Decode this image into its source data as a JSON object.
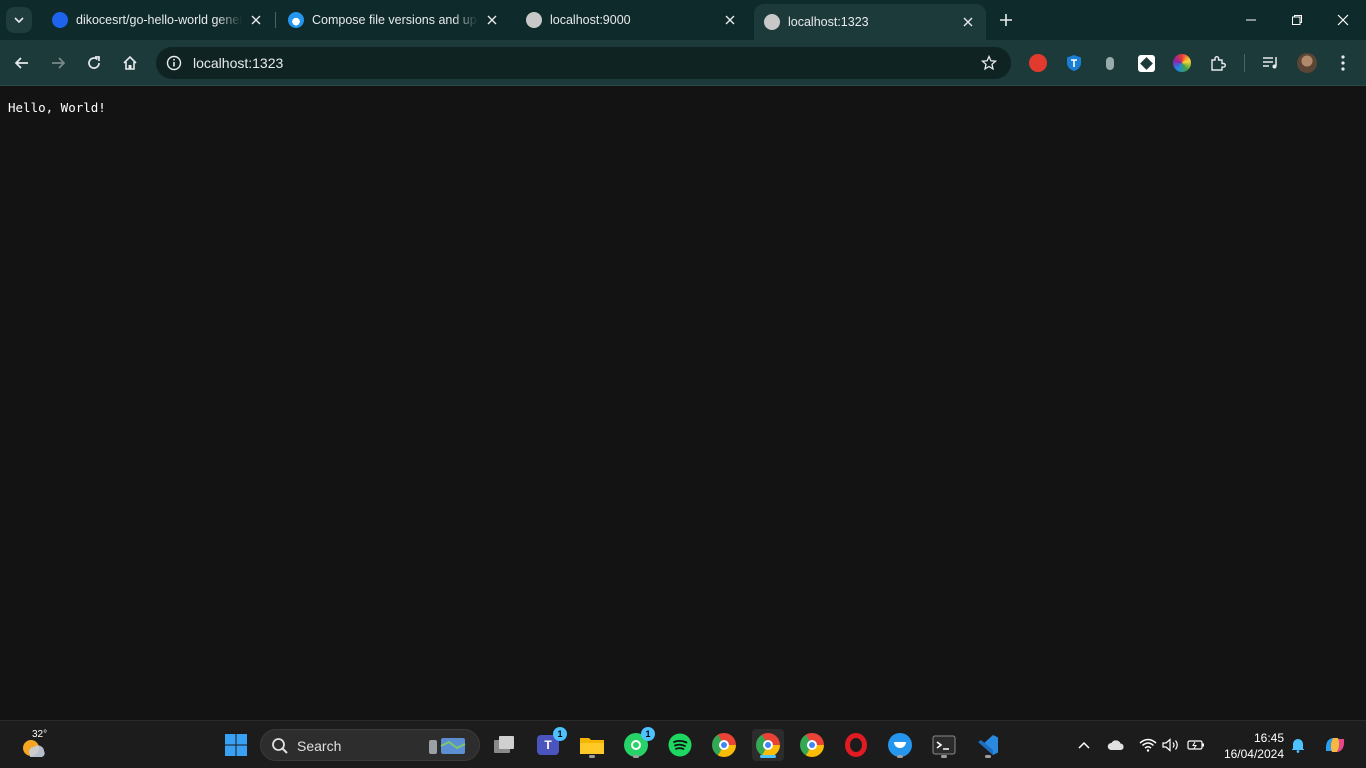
{
  "browser": {
    "tabs": [
      {
        "title": "dikocesrt/go-hello-world gener",
        "icon": "docker-icon",
        "active": false
      },
      {
        "title": "Compose file versions and upgr",
        "icon": "docker-docs-icon",
        "active": false
      },
      {
        "title": "localhost:9000",
        "icon": "globe-icon",
        "active": false
      },
      {
        "title": "localhost:1323",
        "icon": "globe-icon",
        "active": true
      }
    ],
    "address": "localhost:1323"
  },
  "page": {
    "body_text": "Hello, World!"
  },
  "taskbar": {
    "weather_temp": "32°",
    "search_label": "Search",
    "teams_badge": "1",
    "whatsapp_badge": "1",
    "time": "16:45",
    "date": "16/04/2024"
  },
  "colors": {
    "titlebar": "#0f2a2a",
    "toolbar": "#1d3a3a",
    "page_bg": "#131313",
    "taskbar": "#1c1c1c",
    "accent": "#4cc2ff"
  }
}
